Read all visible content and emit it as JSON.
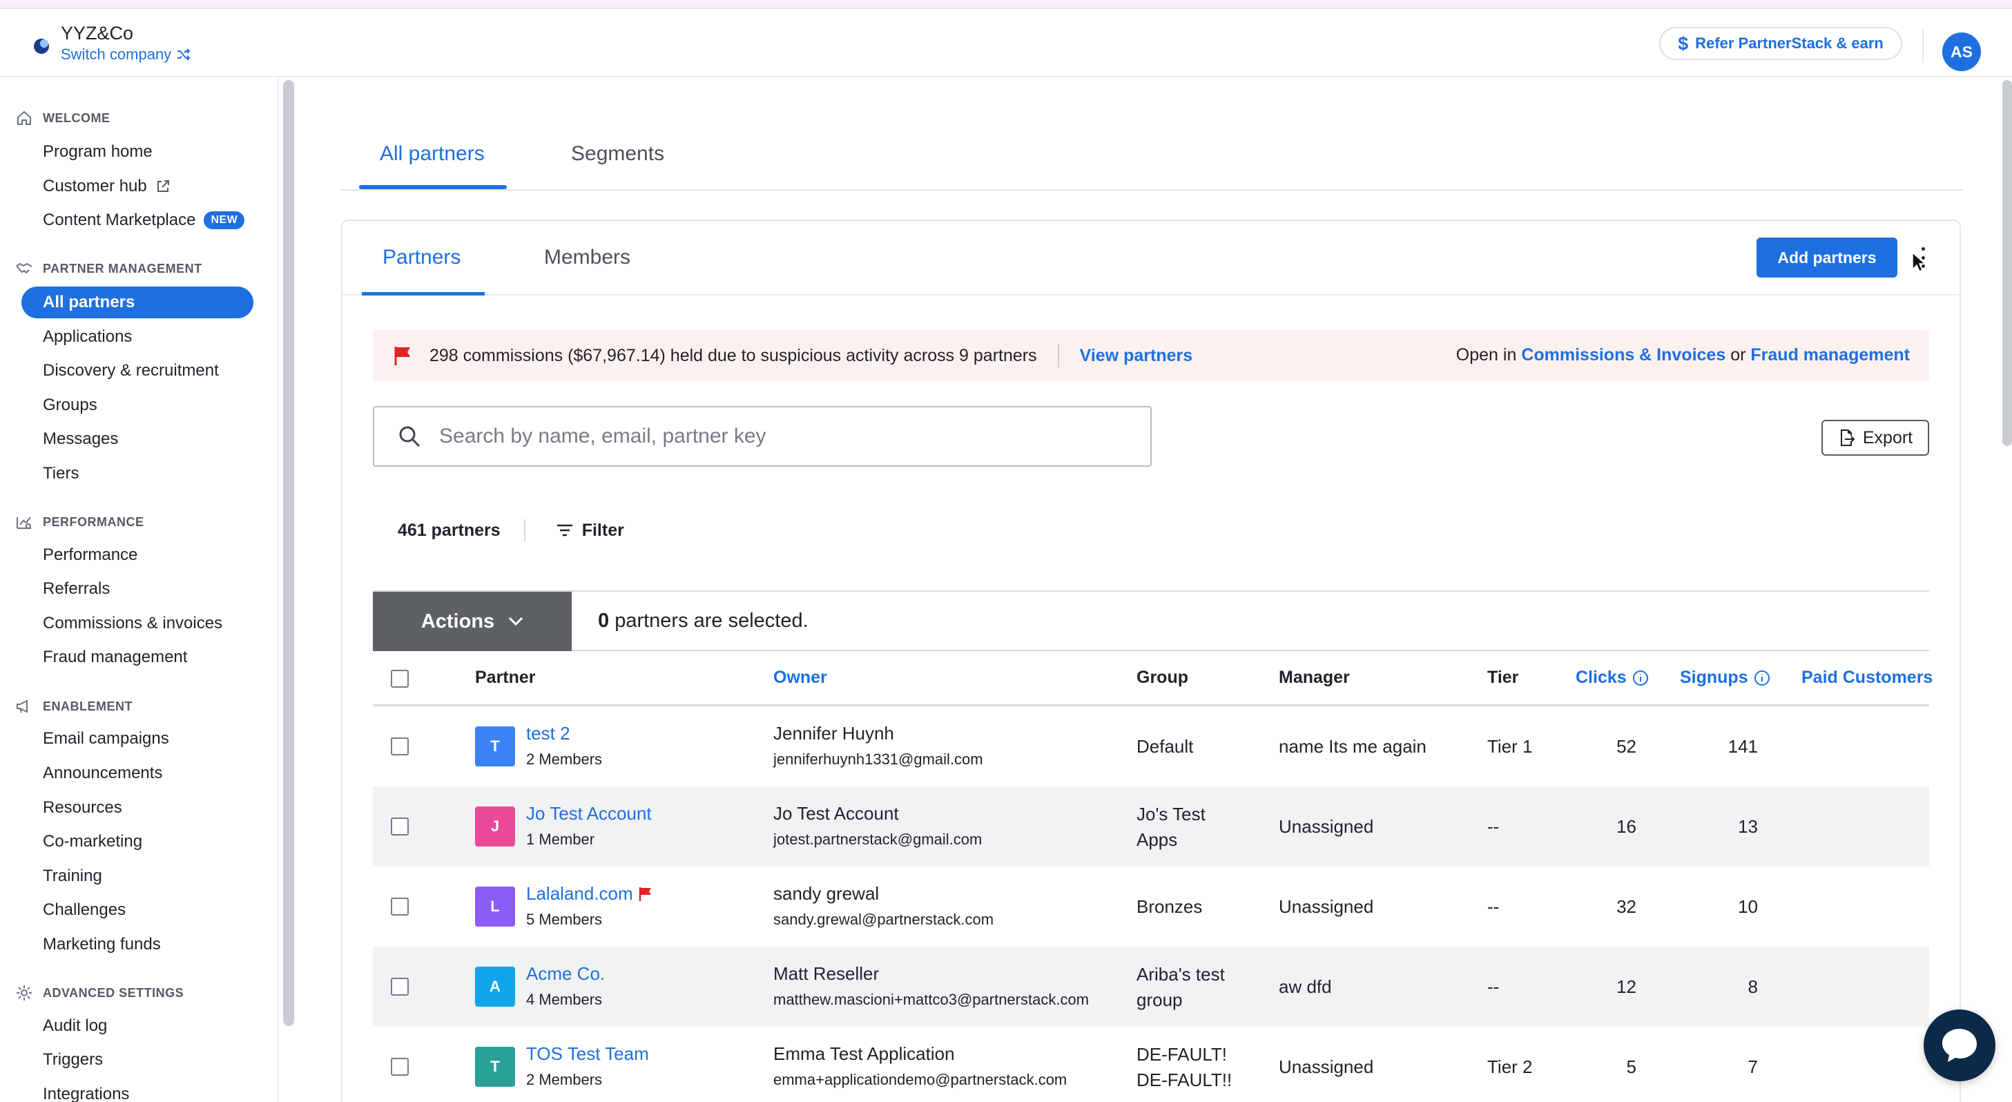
{
  "header": {
    "company": "YYZ&Co",
    "switch_label": "Switch company",
    "refer_label": "Refer PartnerStack & earn",
    "avatar_initials": "AS"
  },
  "sidebar": {
    "sections": [
      {
        "title": "WELCOME",
        "icon": "home-icon",
        "items": [
          {
            "label": "Program home"
          },
          {
            "label": "Customer hub",
            "icon": "external-link-icon"
          },
          {
            "label": "Content Marketplace",
            "badge": "NEW"
          }
        ]
      },
      {
        "title": "PARTNER MANAGEMENT",
        "icon": "handshake-icon",
        "items": [
          {
            "label": "All partners",
            "active": true
          },
          {
            "label": "Applications"
          },
          {
            "label": "Discovery & recruitment"
          },
          {
            "label": "Groups"
          },
          {
            "label": "Messages"
          },
          {
            "label": "Tiers"
          }
        ]
      },
      {
        "title": "PERFORMANCE",
        "icon": "performance-chart-icon",
        "items": [
          {
            "label": "Performance"
          },
          {
            "label": "Referrals"
          },
          {
            "label": "Commissions & invoices"
          },
          {
            "label": "Fraud management"
          }
        ]
      },
      {
        "title": "ENABLEMENT",
        "icon": "megaphone-icon",
        "items": [
          {
            "label": "Email campaigns"
          },
          {
            "label": "Announcements"
          },
          {
            "label": "Resources"
          },
          {
            "label": "Co-marketing"
          },
          {
            "label": "Training"
          },
          {
            "label": "Challenges"
          },
          {
            "label": "Marketing funds"
          }
        ]
      },
      {
        "title": "ADVANCED SETTINGS",
        "icon": "gear-icon",
        "items": [
          {
            "label": "Audit log"
          },
          {
            "label": "Triggers"
          },
          {
            "label": "Integrations"
          }
        ]
      }
    ]
  },
  "top_tabs": [
    {
      "label": "All partners",
      "active": true
    },
    {
      "label": "Segments"
    }
  ],
  "card": {
    "tabs": [
      {
        "label": "Partners",
        "active": true
      },
      {
        "label": "Members"
      }
    ],
    "add_partners_label": "Add partners"
  },
  "alert": {
    "message": "298 commissions ($67,967.14) held due to suspicious activity across 9 partners",
    "view_link": "View partners",
    "open_in": "Open in",
    "link1": "Commissions & Invoices",
    "or": "or",
    "link2": "Fraud management"
  },
  "search": {
    "placeholder": "Search by name, email, partner key",
    "value": ""
  },
  "export_label": "Export",
  "partner_count": "461 partners",
  "filter_label": "Filter",
  "actions": {
    "label": "Actions",
    "selected_count": "0",
    "selected_suffix": " partners are selected."
  },
  "table": {
    "columns": [
      "Partner",
      "Owner",
      "Group",
      "Manager",
      "Tier",
      "Clicks",
      "Signups",
      "Paid Customers"
    ],
    "rows": [
      {
        "initial": "T",
        "color": "#3b82f6",
        "name": "test 2",
        "members": "2 Members",
        "owner": "Jennifer Huynh",
        "email": "jenniferhuynh1331@gmail.com",
        "group": [
          "Default"
        ],
        "manager": "name Its me again",
        "tier": "Tier 1",
        "clicks": "52",
        "signups": "141",
        "flagged": false
      },
      {
        "initial": "J",
        "color": "#ec4899",
        "name": "Jo Test Account",
        "members": "1 Member",
        "owner": "Jo Test Account",
        "email": "jotest.partnerstack@gmail.com",
        "group": [
          "Jo's Test",
          "Apps"
        ],
        "manager": "Unassigned",
        "tier": "--",
        "clicks": "16",
        "signups": "13",
        "flagged": false
      },
      {
        "initial": "L",
        "color": "#8b5cf6",
        "name": "Lalaland.com",
        "members": "5 Members",
        "owner": "sandy grewal",
        "email": "sandy.grewal@partnerstack.com",
        "group": [
          "Bronzes"
        ],
        "manager": "Unassigned",
        "tier": "--",
        "clicks": "32",
        "signups": "10",
        "flagged": true
      },
      {
        "initial": "A",
        "color": "#0ea5e9",
        "name": "Acme Co.",
        "members": "4 Members",
        "owner": "Matt Reseller",
        "email": "matthew.mascioni+mattco3@partnerstack.com",
        "group": [
          "Ariba's test",
          "group"
        ],
        "manager": "aw dfd",
        "tier": "--",
        "clicks": "12",
        "signups": "8",
        "flagged": false
      },
      {
        "initial": "T",
        "color": "#2aa198",
        "name": "TOS Test Team",
        "members": "2 Members",
        "owner": "Emma Test Application",
        "email": "emma+applicationdemo@partnerstack.com",
        "group": [
          "DE-FAULT!",
          "DE-FAULT!!"
        ],
        "manager": "Unassigned",
        "tier": "Tier 2",
        "clicks": "5",
        "signups": "7",
        "flagged": false
      }
    ]
  },
  "colors": {
    "accent": "#1e6fe0",
    "alert_bg": "#fdf1ef",
    "flag": "#e02424",
    "actions_bg": "#5d6166"
  }
}
